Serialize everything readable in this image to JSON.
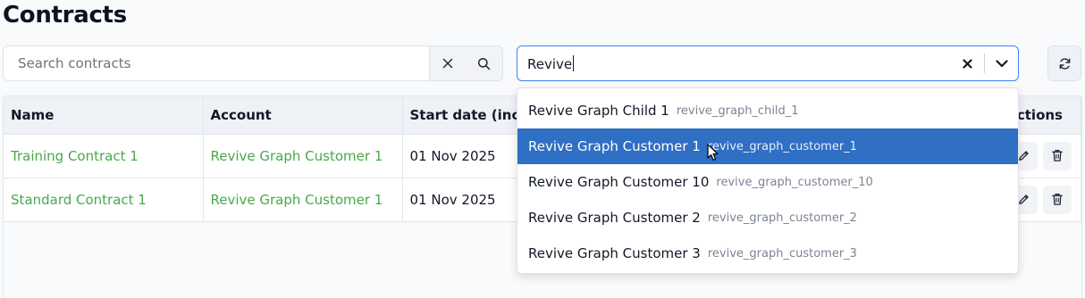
{
  "page": {
    "title": "Contracts"
  },
  "search": {
    "placeholder": "Search contracts",
    "value": ""
  },
  "account_filter": {
    "value": "Revive"
  },
  "table": {
    "columns": [
      "Name",
      "Account",
      "Start date (incl",
      "Actions"
    ],
    "rows": [
      {
        "name": "Training Contract 1",
        "account": "Revive Graph Customer 1",
        "start_date": "01 Nov 2025"
      },
      {
        "name": "Standard Contract 1",
        "account": "Revive Graph Customer 1",
        "start_date": "01 Nov 2025"
      }
    ]
  },
  "dropdown": {
    "options": [
      {
        "label": "Revive Graph Child 1",
        "code": "revive_graph_child_1"
      },
      {
        "label": "Revive Graph Customer 1",
        "code": "revive_graph_customer_1"
      },
      {
        "label": "Revive Graph Customer 10",
        "code": "revive_graph_customer_10"
      },
      {
        "label": "Revive Graph Customer 2",
        "code": "revive_graph_customer_2"
      },
      {
        "label": "Revive Graph Customer 3",
        "code": "revive_graph_customer_3"
      }
    ],
    "highlighted_index": 1
  },
  "icons": {
    "search_clear": "close-icon",
    "search": "search-icon",
    "select_clear": "close-icon",
    "select_toggle": "chevron-down-icon",
    "refresh": "refresh-icon",
    "edit": "pencil-icon",
    "delete": "trash-icon"
  },
  "colors": {
    "accent": "#2f6fc4",
    "link": "#4aa84a",
    "focus_border": "#3b82f6"
  }
}
